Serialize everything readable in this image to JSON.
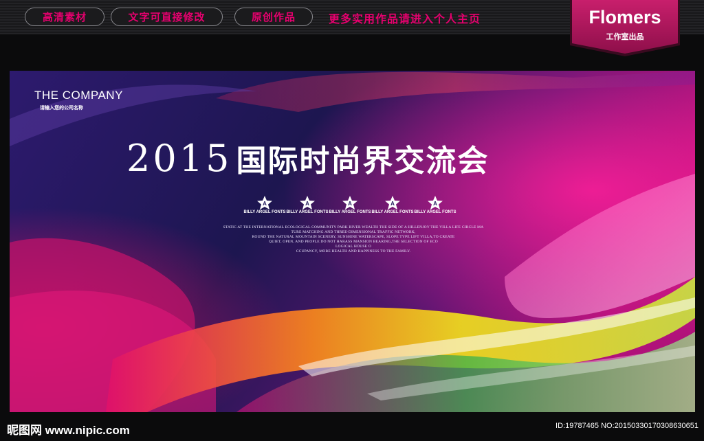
{
  "topbar": {
    "tags": [
      "高清素材",
      "文字可直接修改",
      "原创作品"
    ],
    "promo": "更多实用作品请进入个人主页"
  },
  "badge": {
    "title": "Flomers",
    "subtitle": "工作室出品"
  },
  "poster": {
    "company": "THE COMPANY",
    "company_sub": "请输入您的公司名称",
    "headline_year": "2015",
    "headline_text": "国际时尚界交流会",
    "logos": [
      {
        "mark": "A",
        "label": "BILLY ARGEL FONTS"
      },
      {
        "mark": "A",
        "label": "BILLY ARGEL FONTS"
      },
      {
        "mark": "A",
        "label": "BILLY ARGEL FONTS"
      },
      {
        "mark": "A",
        "label": "BILLY ARGEL FONTS"
      },
      {
        "mark": "A",
        "label": "BILLY ARGEL FONTS"
      }
    ],
    "blurb_lines": [
      "STATIC AT THE INTERNATIONAL ECOLOGICAL COMMUNITY PARK RIVER WEALTH THE SIDE OF A HILLENJOY THE VILLA LIFE CIRCLE MA",
      "TURE MATCHING AND THREE-DIMENSIONAL TRAFFIC NETWORK,",
      "ROUND THE NATURAL MOUNTAIN SCENERY, SUNSHINE WATERSCAPE, SLOPE TYPE LIFT VILLA,TO CREATE",
      "QUIET, OPEN, AND PEOPLE DO NOT HARASS MANSION BEARING,THE SELECTION OF ECO",
      "LOGICAL HOUSE O",
      "CCUPANCY, MORE HEALTH AND HAPPINESS TO THE FAMILY."
    ]
  },
  "footer": {
    "watermark_left": "昵图网 www.nipic.com",
    "watermark_right": "ID:19787465 NO:20150330170308630651"
  },
  "colors": {
    "accent": "#e6006e",
    "badge": "#b0165e",
    "poster_base": "#221a5c"
  }
}
